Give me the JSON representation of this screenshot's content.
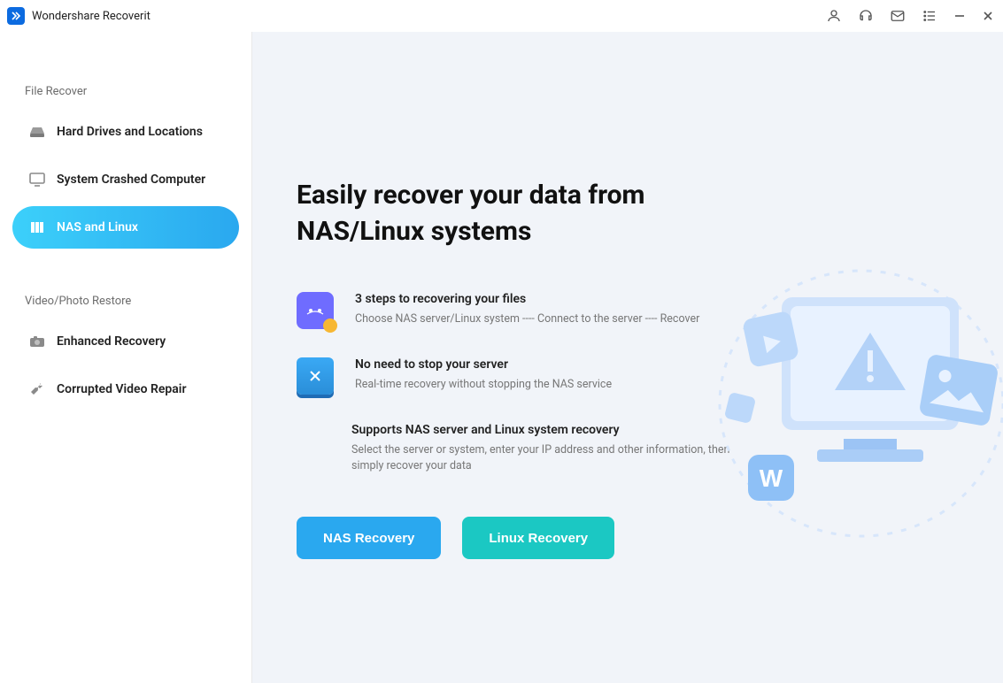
{
  "app": {
    "title": "Wondershare Recoverit"
  },
  "sidebar": {
    "section1_title": "File Recover",
    "items1": [
      {
        "label": "Hard Drives and Locations"
      },
      {
        "label": "System Crashed Computer"
      },
      {
        "label": "NAS and Linux"
      }
    ],
    "section2_title": "Video/Photo Restore",
    "items2": [
      {
        "label": "Enhanced Recovery"
      },
      {
        "label": "Corrupted Video Repair"
      }
    ]
  },
  "main": {
    "hero_line1": "Easily recover your data from",
    "hero_line2": "NAS/Linux systems",
    "features": [
      {
        "title": "3 steps to recovering your files",
        "desc": "Choose NAS server/Linux system ---- Connect to the server ---- Recover"
      },
      {
        "title": "No need to stop your server",
        "desc": "Real-time recovery without stopping the NAS service"
      },
      {
        "title_pre": "Supports ",
        "title_link1": "NAS server",
        "title_mid": " and ",
        "title_link2": "Linux system",
        "title_post": " recovery",
        "desc": "Select the server or system, enter your IP address and other information, then simply recover your data"
      }
    ],
    "buttons": {
      "nas": "NAS Recovery",
      "linux": "Linux Recovery"
    }
  }
}
